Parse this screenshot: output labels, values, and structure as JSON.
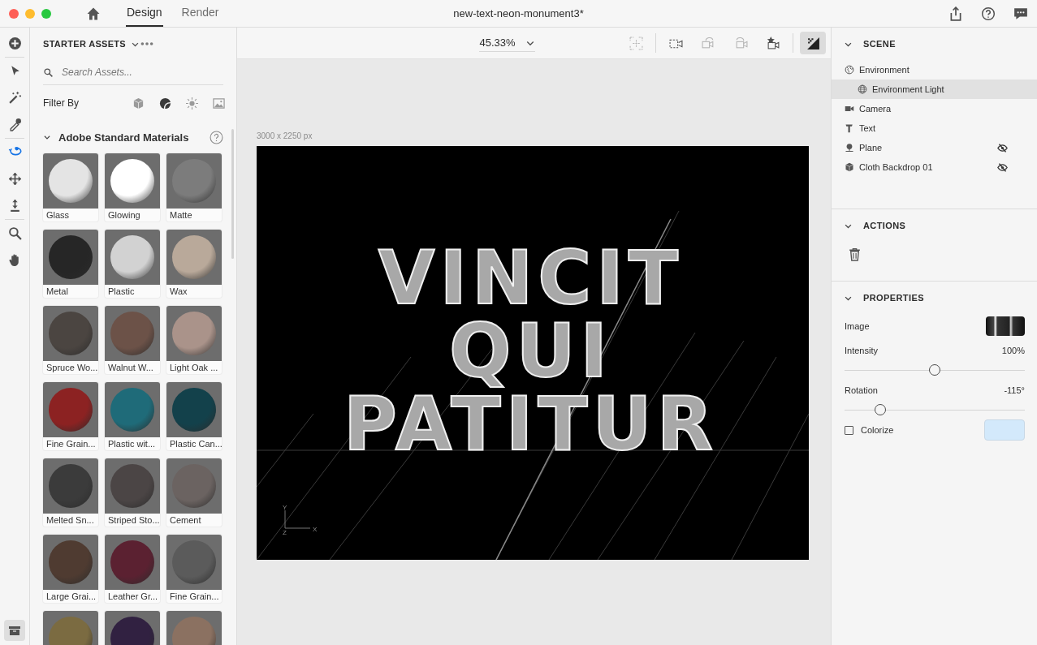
{
  "window": {
    "title": "new-text-neon-monument3*"
  },
  "tabs": [
    {
      "label": "Design",
      "selected": true
    },
    {
      "label": "Render",
      "selected": false
    }
  ],
  "tools": [
    {
      "kind": "add",
      "selected": false
    },
    {
      "kind": "select",
      "selected": false
    },
    {
      "kind": "wand",
      "selected": false
    },
    {
      "kind": "eyedropper",
      "selected": false
    },
    {
      "kind": "orbit",
      "selected": true
    },
    {
      "kind": "move",
      "selected": false
    },
    {
      "kind": "dolly",
      "selected": false
    },
    {
      "kind": "zoom",
      "selected": false
    },
    {
      "kind": "pan",
      "selected": false
    }
  ],
  "assets": {
    "title": "STARTER ASSETS",
    "search": {
      "placeholder": "Search Assets..."
    },
    "filter_label": "Filter By",
    "filters": [
      {
        "kind": "model",
        "selected": false
      },
      {
        "kind": "material",
        "selected": true
      },
      {
        "kind": "light",
        "selected": false
      },
      {
        "kind": "image",
        "selected": false
      }
    ],
    "section": {
      "title": "Adobe Standard Materials",
      "expanded": true
    },
    "materials": [
      {
        "name": "Glass",
        "color": "#e4e4e4"
      },
      {
        "name": "Glowing",
        "color": "#ffffff"
      },
      {
        "name": "Matte",
        "color": "#7c7c7c"
      },
      {
        "name": "Metal",
        "color": "#262626"
      },
      {
        "name": "Plastic",
        "color": "#d2d2d2"
      },
      {
        "name": "Wax",
        "color": "#b9a99a"
      },
      {
        "name": "Spruce Wo...",
        "color": "#4b4541"
      },
      {
        "name": "Walnut W...",
        "color": "#6c5248"
      },
      {
        "name": "Light Oak ...",
        "color": "#aa938a"
      },
      {
        "name": "Fine Grain...",
        "color": "#8c2222"
      },
      {
        "name": "Plastic wit...",
        "color": "#1f6b79"
      },
      {
        "name": "Plastic Can...",
        "color": "#13414b"
      },
      {
        "name": "Melted Sn...",
        "color": "#3b3b3b"
      },
      {
        "name": "Striped Sto...",
        "color": "#4b4545"
      },
      {
        "name": "Cement",
        "color": "#6b6361"
      },
      {
        "name": "Large Grai...",
        "color": "#4f3b31"
      },
      {
        "name": "Leather Gr...",
        "color": "#5b2131"
      },
      {
        "name": "Fine Grain...",
        "color": "#5b5b5b"
      },
      {
        "color": "#7b6b41"
      },
      {
        "color": "#312141"
      },
      {
        "color": "#8b7161"
      }
    ]
  },
  "viewport": {
    "zoom": "45.33%",
    "tools": [
      {
        "kind": "frame",
        "disabled": true,
        "selected": false
      },
      {
        "kind": "camera-frame",
        "disabled": false,
        "selected": false
      },
      {
        "kind": "camera-back",
        "disabled": true,
        "selected": false
      },
      {
        "kind": "camera-forward",
        "disabled": true,
        "selected": false
      },
      {
        "kind": "camera-star",
        "disabled": false,
        "selected": false
      },
      {
        "kind": "preview",
        "disabled": false,
        "selected": true
      }
    ],
    "size": "3000 x 2250 px",
    "render_text": [
      "VINCIT",
      "QUI",
      "PATITUR"
    ],
    "axes": [
      "Y",
      "Z",
      "X"
    ]
  },
  "scene": {
    "title": "SCENE",
    "expanded": true,
    "items": [
      {
        "name": "Environment",
        "kind": "environment",
        "selected": false,
        "hidden": false,
        "children": [
          {
            "name": "Environment Light",
            "kind": "light",
            "selected": true,
            "hidden": false
          }
        ]
      },
      {
        "name": "Camera",
        "kind": "camera",
        "selected": false,
        "hidden": false
      },
      {
        "name": "Text",
        "kind": "text",
        "selected": false,
        "hidden": false
      },
      {
        "name": "Plane",
        "kind": "plane",
        "selected": false,
        "hidden": true
      },
      {
        "name": "Cloth Backdrop 01",
        "kind": "model",
        "selected": false,
        "hidden": true
      }
    ]
  },
  "actions": {
    "title": "ACTIONS",
    "expanded": true
  },
  "properties": {
    "title": "PROPERTIES",
    "expanded": true,
    "rows": [
      {
        "kind": "image",
        "label": "Image"
      },
      {
        "kind": "slider",
        "label": "Intensity",
        "reading": "100%",
        "level": 0.5
      },
      {
        "kind": "slider",
        "label": "Rotation",
        "reading": "-115°",
        "level": 0.2
      },
      {
        "kind": "checkbox",
        "label": "Colorize",
        "checked": false,
        "color": "#d3e9fb"
      }
    ]
  }
}
